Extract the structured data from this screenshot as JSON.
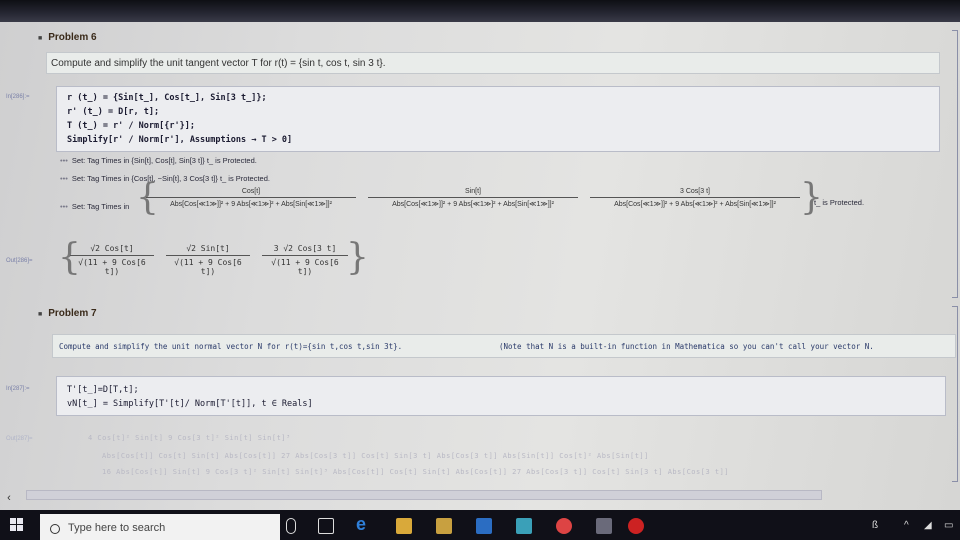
{
  "problem6": {
    "title": "Problem 6",
    "description": "Compute and simplify the unit tangent vector T for r(t) = {sin t, cos t, sin 3 t}.",
    "input_label": "In[286]:=",
    "code": [
      "r (t_) = {Sin[t_], Cos[t_], Sin[3 t_]};",
      "r' (t_) = D[r, t];",
      "T (t_) = r' / Norm[{r'}];",
      "Simplify[r' / Norm[r'], Assumptions → T > 0]"
    ],
    "messages": [
      "Set: Tag Times in {Sin[t], Cos[t], Sin[3 t]} t_ is Protected.",
      "Set: Tag Times in {Cos[t], −Sin[t], 3 Cos[3 t]} t_ is Protected.",
      "Set: Tag Times in"
    ],
    "msg3_fractions": [
      {
        "num": "Cos[t]",
        "den": "Abs[Cos[≪1≫]]² + 9 Abs[≪1≫]² + Abs[Sin[≪1≫]]²"
      },
      {
        "num": "Sin[t]",
        "den": "Abs[Cos[≪1≫]]² + 9 Abs[≪1≫]² + Abs[Sin[≪1≫]]²"
      },
      {
        "num": "3 Cos[3 t]",
        "den": "Abs[Cos[≪1≫]]² + 9 Abs[≪1≫]² + Abs[Sin[≪1≫]]²"
      }
    ],
    "msg3_suffix": "t_ is Protected.",
    "output_label": "Out[286]=",
    "output": [
      {
        "num": "√2 Cos[t]",
        "den": "√(11 + 9 Cos[6 t])"
      },
      {
        "num": "√2 Sin[t]",
        "den": "√(11 + 9 Cos[6 t])"
      },
      {
        "num": "3 √2 Cos[3 t]",
        "den": "√(11 + 9 Cos[6 t])"
      }
    ]
  },
  "problem7": {
    "title": "Problem 7",
    "description": "Compute and simplify the unit normal vector N for r(t)={sin t,cos t,sin 3t}.",
    "note": "(Note that N is a built-in function in Mathematica so you can't call your vector N.",
    "input_label": "In[287]:=",
    "code": [
      "T'[t_]=D[T,t];",
      "vN[t_] = Simplify[T'[t]/ Norm[T'[t]], t ∈ Reals]"
    ],
    "output_label": "Out[287]=",
    "faded_output": [
      "4 Cos[t]² Sin[t]   9 Cos[3 t]² Sin[t]   Sin[t]³",
      "Abs[Cos[t]] Cos[t] Sin[t] Abs[Cos[t]]   27 Abs[Cos[3 t]]   Cos[t] Sin[3 t] Abs[Cos[3 t]]   Abs[Sin[t]]   Cos[t]² Abs[Sin[t]]",
      "16 Abs[Cos[t]] Sin[t]   9 Cos[3 t]² Sin[t]   Sin[t]³   Abs[Cos[t]]   Cos[t] Sin[t] Abs[Cos[t]]   27 Abs[Cos[3 t]] Cos[t] Sin[3 t] Abs[Cos[3 t]]"
    ]
  },
  "taskbar": {
    "search_placeholder": "Type here to search",
    "tray_text": "ß"
  },
  "colors": {
    "notebook_bg": "#dcdcdc",
    "taskbar_bg": "#101018",
    "edge_icon": "#2f7fd8",
    "store_icon": "#c8a040",
    "word_icon": "#2b6dc2",
    "chrome_icon": "#d44",
    "app_icon": "#3aa0b8"
  }
}
